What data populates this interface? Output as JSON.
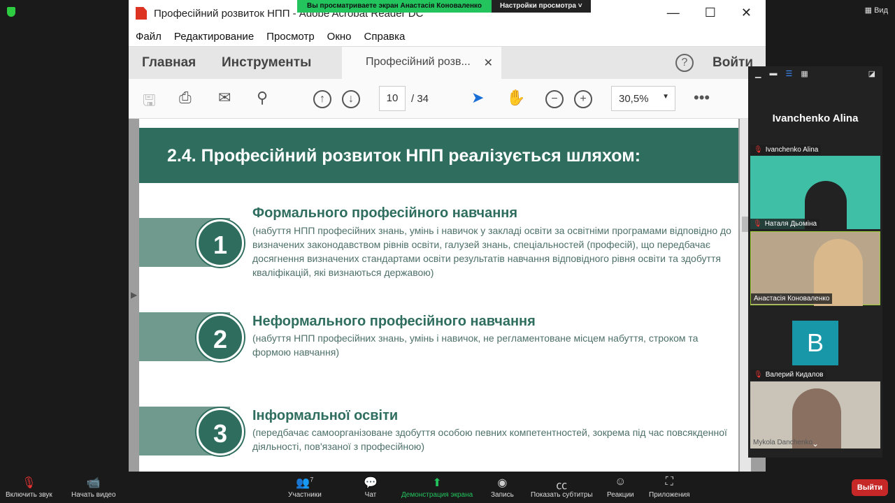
{
  "banner": {
    "viewing": "Вы просматриваете экран Анастасія Коноваленко",
    "settings": "Настройки просмотра"
  },
  "view_label": "Вид",
  "acrobat": {
    "title": "Професійний розвиток НПП - Adobe Acrobat Reader DC",
    "menu": [
      "Файл",
      "Редактирование",
      "Просмотр",
      "Окно",
      "Справка"
    ],
    "tabs": {
      "home": "Главная",
      "tools": "Инструменты",
      "doc": "Професійний розв...",
      "signin": "Войти"
    },
    "page_current": "10",
    "page_total": "/ 34",
    "zoom": "30,5%"
  },
  "slide": {
    "heading": "2.4. Професійний розвиток НПП реалізується шляхом:",
    "items": [
      {
        "num": "1",
        "title": "Формального професійного навчання",
        "desc": "(набуття НПП професійних знань, умінь і навичок у закладі освіти за освітніми програмами відповідно до визначених законодавством рівнів освіти, галузей знань, спеціальностей (професій), що передбачає досягнення визначених стандартами освіти результатів навчання відповідного рівня освіти та здобуття кваліфікацій, які визнаються державою)"
      },
      {
        "num": "2",
        "title": "Неформального професійного навчання",
        "desc": "(набуття НПП професійних знань, умінь і навичок, не регламентоване місцем набуття, строком та формою навчання)"
      },
      {
        "num": "3",
        "title": "Інформальної освіти",
        "desc": "(передбачає самоорганізоване здобуття особою певних компетентностей, зокрема під час повсякденної діяльності, пов'язаної з професійною)"
      }
    ]
  },
  "participants_panel": {
    "active_speaker": "Ivanchenko Alina",
    "tiles": [
      {
        "name": "Ivanchenko Alina",
        "muted": true
      },
      {
        "name": "Наталя Дьоміна",
        "muted": true
      },
      {
        "name": "Анастасія Коноваленко",
        "muted": false
      },
      {
        "name": "Валерий Кидалов",
        "muted": true,
        "avatar": "В"
      },
      {
        "name": "Mykola Danchenko",
        "muted": false
      }
    ]
  },
  "bottom": {
    "unmute": "Включить звук",
    "video": "Начать видео",
    "participants": "Участники",
    "participants_count": "7",
    "chat": "Чат",
    "share": "Демонстрация экрана",
    "record": "Запись",
    "captions": "Показать субтитры",
    "reactions": "Реакции",
    "apps": "Приложения",
    "leave": "Выйти"
  }
}
